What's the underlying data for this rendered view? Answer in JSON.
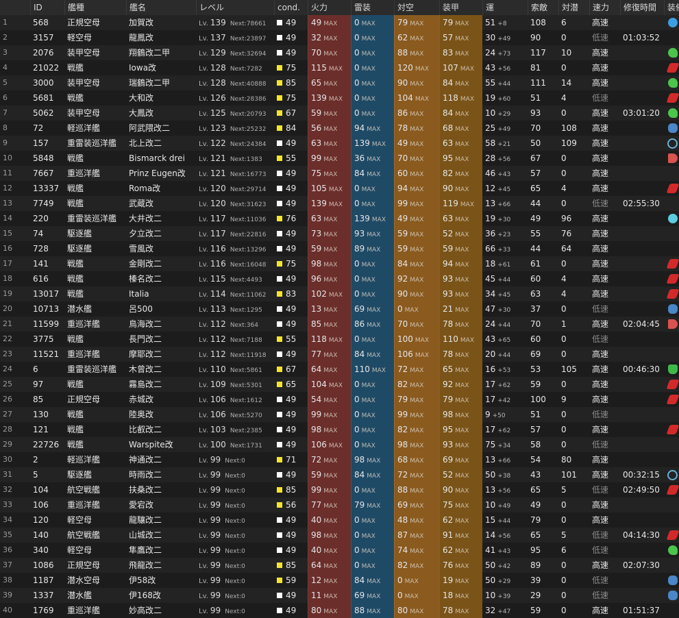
{
  "colors": {
    "fire": "#6b2e2b",
    "torpedo": "#1f4a66",
    "aa": "#8a5a1f",
    "armor": "#7a5318",
    "cond_white": "#ffffff",
    "cond_yellow": "#f5e52e"
  },
  "header": {
    "idx": "",
    "id": "ID",
    "type": "艦種",
    "name": "艦名",
    "level": "レベル",
    "cond": "cond.",
    "fire": "火力",
    "torpedo": "雷装",
    "aa": "対空",
    "armor": "装甲",
    "luck": "運",
    "los": "索敵",
    "asw": "対潜",
    "speed": "速力",
    "repair": "修復時間",
    "equip": "装備"
  },
  "max_label": "MAX",
  "lv_prefix": "Lv.",
  "next_prefix": "Next:",
  "rows": [
    {
      "idx": "1",
      "id": "568",
      "type": "正規空母",
      "name": "加賀改",
      "lv": "139",
      "next": "78661",
      "cond": "49",
      "cc": "w",
      "fire": "49",
      "torp": "0",
      "aa": "79",
      "arm": "79",
      "luck": "51",
      "lup": "+8",
      "los": "108",
      "asw": "6",
      "speed": "高速",
      "repair": "",
      "eq": "blue-plane-icon"
    },
    {
      "idx": "2",
      "id": "3157",
      "type": "軽空母",
      "name": "龍鳳改",
      "lv": "137",
      "next": "23897",
      "cond": "49",
      "cc": "w",
      "fire": "32",
      "torp": "0",
      "aa": "62",
      "arm": "57",
      "luck": "30",
      "lup": "+49",
      "los": "90",
      "asw": "0",
      "speed": "低速",
      "repair": "01:03:52",
      "eq": ""
    },
    {
      "idx": "3",
      "id": "2076",
      "type": "装甲空母",
      "name": "翔鶴改二甲",
      "lv": "129",
      "next": "32694",
      "cond": "49",
      "cc": "w",
      "fire": "70",
      "torp": "0",
      "aa": "88",
      "arm": "83",
      "luck": "24",
      "lup": "+73",
      "los": "117",
      "asw": "10",
      "speed": "高速",
      "repair": "",
      "eq": "green-plane-icon"
    },
    {
      "idx": "4",
      "id": "21022",
      "type": "戦艦",
      "name": "Iowa改",
      "lv": "128",
      "next": "7282",
      "cond": "75",
      "cc": "y",
      "fire": "115",
      "torp": "0",
      "aa": "120",
      "arm": "107",
      "luck": "43",
      "lup": "+56",
      "los": "81",
      "asw": "0",
      "speed": "高速",
      "repair": "",
      "eq": "red-gun-icon"
    },
    {
      "idx": "5",
      "id": "3000",
      "type": "装甲空母",
      "name": "瑞鶴改二甲",
      "lv": "128",
      "next": "40888",
      "cond": "85",
      "cc": "y",
      "fire": "65",
      "torp": "0",
      "aa": "90",
      "arm": "84",
      "luck": "55",
      "lup": "+44",
      "los": "111",
      "asw": "14",
      "speed": "高速",
      "repair": "",
      "eq": "green-plane-icon"
    },
    {
      "idx": "6",
      "id": "5681",
      "type": "戦艦",
      "name": "大和改",
      "lv": "126",
      "next": "28386",
      "cond": "75",
      "cc": "y",
      "fire": "139",
      "torp": "0",
      "aa": "104",
      "arm": "118",
      "luck": "19",
      "lup": "+60",
      "los": "51",
      "asw": "4",
      "speed": "低速",
      "repair": "",
      "eq": "red-gun-icon"
    },
    {
      "idx": "7",
      "id": "5062",
      "type": "装甲空母",
      "name": "大鳳改",
      "lv": "125",
      "next": "20793",
      "cond": "67",
      "cc": "y",
      "fire": "59",
      "torp": "0",
      "aa": "86",
      "arm": "84",
      "luck": "10",
      "lup": "+29",
      "los": "93",
      "asw": "0",
      "speed": "高速",
      "repair": "03:01:20",
      "eq": "green-plane-icon"
    },
    {
      "idx": "8",
      "id": "72",
      "type": "軽巡洋艦",
      "name": "阿武隈改二",
      "lv": "123",
      "next": "25232",
      "cond": "84",
      "cc": "y",
      "fire": "56",
      "torp": "94",
      "aa": "78",
      "arm": "68",
      "luck": "25",
      "lup": "+49",
      "los": "70",
      "asw": "108",
      "speed": "高速",
      "repair": "",
      "eq": "blue-sonar-icon"
    },
    {
      "idx": "9",
      "id": "157",
      "type": "重雷装巡洋艦",
      "name": "北上改二",
      "lv": "122",
      "next": "24384",
      "cond": "49",
      "cc": "w",
      "fire": "63",
      "torp": "139",
      "aa": "49",
      "arm": "63",
      "luck": "58",
      "lup": "+21",
      "los": "50",
      "asw": "109",
      "speed": "高速",
      "repair": "",
      "eq": "radar-icon"
    },
    {
      "idx": "10",
      "id": "5848",
      "type": "戦艦",
      "name": "Bismarck drei",
      "lv": "121",
      "next": "1383",
      "cond": "55",
      "cc": "y",
      "fire": "99",
      "torp": "36",
      "aa": "70",
      "arm": "95",
      "luck": "28",
      "lup": "+56",
      "los": "67",
      "asw": "0",
      "speed": "高速",
      "repair": "",
      "eq": "red-shell-icon"
    },
    {
      "idx": "11",
      "id": "7667",
      "type": "重巡洋艦",
      "name": "Prinz Eugen改",
      "lv": "121",
      "next": "16773",
      "cond": "49",
      "cc": "w",
      "fire": "75",
      "torp": "84",
      "aa": "60",
      "arm": "82",
      "luck": "46",
      "lup": "+43",
      "los": "57",
      "asw": "0",
      "speed": "高速",
      "repair": "",
      "eq": ""
    },
    {
      "idx": "12",
      "id": "13337",
      "type": "戦艦",
      "name": "Roma改",
      "lv": "120",
      "next": "29714",
      "cond": "49",
      "cc": "w",
      "fire": "105",
      "torp": "0",
      "aa": "94",
      "arm": "90",
      "luck": "12",
      "lup": "+45",
      "los": "65",
      "asw": "4",
      "speed": "高速",
      "repair": "",
      "eq": "red-gun-icon"
    },
    {
      "idx": "13",
      "id": "7749",
      "type": "戦艦",
      "name": "武蔵改",
      "lv": "120",
      "next": "31623",
      "cond": "49",
      "cc": "w",
      "fire": "139",
      "torp": "0",
      "aa": "99",
      "arm": "119",
      "luck": "13",
      "lup": "+66",
      "los": "44",
      "asw": "0",
      "speed": "低速",
      "repair": "02:55:30",
      "eq": ""
    },
    {
      "idx": "14",
      "id": "220",
      "type": "重雷装巡洋艦",
      "name": "大井改二",
      "lv": "117",
      "next": "11036",
      "cond": "76",
      "cc": "y",
      "fire": "63",
      "torp": "139",
      "aa": "49",
      "arm": "63",
      "luck": "19",
      "lup": "+30",
      "los": "49",
      "asw": "96",
      "speed": "高速",
      "repair": "",
      "eq": "cyan-torpedo-icon"
    },
    {
      "idx": "15",
      "id": "74",
      "type": "駆逐艦",
      "name": "夕立改二",
      "lv": "117",
      "next": "22816",
      "cond": "49",
      "cc": "w",
      "fire": "73",
      "torp": "93",
      "aa": "59",
      "arm": "52",
      "luck": "36",
      "lup": "+23",
      "los": "55",
      "asw": "76",
      "speed": "高速",
      "repair": "",
      "eq": ""
    },
    {
      "idx": "16",
      "id": "728",
      "type": "駆逐艦",
      "name": "雪風改",
      "lv": "116",
      "next": "13296",
      "cond": "49",
      "cc": "w",
      "fire": "59",
      "torp": "89",
      "aa": "59",
      "arm": "59",
      "luck": "66",
      "lup": "+33",
      "los": "44",
      "asw": "64",
      "speed": "高速",
      "repair": "",
      "eq": ""
    },
    {
      "idx": "17",
      "id": "141",
      "type": "戦艦",
      "name": "金剛改二",
      "lv": "116",
      "next": "16048",
      "cond": "75",
      "cc": "y",
      "fire": "98",
      "torp": "0",
      "aa": "84",
      "arm": "94",
      "luck": "18",
      "lup": "+61",
      "los": "61",
      "asw": "0",
      "speed": "高速",
      "repair": "",
      "eq": "red-gun-icon"
    },
    {
      "idx": "18",
      "id": "616",
      "type": "戦艦",
      "name": "榛名改二",
      "lv": "115",
      "next": "4493",
      "cond": "49",
      "cc": "w",
      "fire": "96",
      "torp": "0",
      "aa": "92",
      "arm": "93",
      "luck": "45",
      "lup": "+44",
      "los": "60",
      "asw": "4",
      "speed": "高速",
      "repair": "",
      "eq": "red-gun-icon"
    },
    {
      "idx": "19",
      "id": "13017",
      "type": "戦艦",
      "name": "Italia",
      "lv": "114",
      "next": "11062",
      "cond": "83",
      "cc": "y",
      "fire": "102",
      "torp": "0",
      "aa": "90",
      "arm": "93",
      "luck": "34",
      "lup": "+45",
      "los": "63",
      "asw": "4",
      "speed": "高速",
      "repair": "",
      "eq": "red-gun-icon"
    },
    {
      "idx": "20",
      "id": "10713",
      "type": "潜水艦",
      "name": "呂500",
      "lv": "113",
      "next": "1295",
      "cond": "49",
      "cc": "w",
      "fire": "13",
      "torp": "69",
      "aa": "0",
      "arm": "21",
      "luck": "47",
      "lup": "+30",
      "los": "37",
      "asw": "0",
      "speed": "低速",
      "repair": "",
      "eq": "blue-sonar-icon"
    },
    {
      "idx": "21",
      "id": "11599",
      "type": "重巡洋艦",
      "name": "鳥海改二",
      "lv": "112",
      "next": "364",
      "cond": "49",
      "cc": "w",
      "fire": "85",
      "torp": "86",
      "aa": "70",
      "arm": "78",
      "luck": "24",
      "lup": "+44",
      "los": "70",
      "asw": "1",
      "speed": "高速",
      "repair": "02:04:45",
      "eq": "red-shell-icon"
    },
    {
      "idx": "22",
      "id": "3775",
      "type": "戦艦",
      "name": "長門改二",
      "lv": "112",
      "next": "7188",
      "cond": "55",
      "cc": "y",
      "fire": "118",
      "torp": "0",
      "aa": "100",
      "arm": "110",
      "luck": "43",
      "lup": "+65",
      "los": "60",
      "asw": "0",
      "speed": "低速",
      "repair": "",
      "eq": ""
    },
    {
      "idx": "23",
      "id": "11521",
      "type": "重巡洋艦",
      "name": "摩耶改二",
      "lv": "112",
      "next": "11918",
      "cond": "49",
      "cc": "w",
      "fire": "77",
      "torp": "84",
      "aa": "106",
      "arm": "78",
      "luck": "20",
      "lup": "+44",
      "los": "69",
      "asw": "0",
      "speed": "高速",
      "repair": "",
      "eq": ""
    },
    {
      "idx": "24",
      "id": "6",
      "type": "重雷装巡洋艦",
      "name": "木曾改二",
      "lv": "110",
      "next": "5861",
      "cond": "67",
      "cc": "y",
      "fire": "64",
      "torp": "110",
      "aa": "72",
      "arm": "65",
      "luck": "16",
      "lup": "+53",
      "los": "53",
      "asw": "105",
      "speed": "高速",
      "repair": "00:46:30",
      "eq": "green-hand-icon"
    },
    {
      "idx": "25",
      "id": "97",
      "type": "戦艦",
      "name": "霧島改二",
      "lv": "109",
      "next": "5301",
      "cond": "65",
      "cc": "y",
      "fire": "104",
      "torp": "0",
      "aa": "82",
      "arm": "92",
      "luck": "17",
      "lup": "+62",
      "los": "59",
      "asw": "0",
      "speed": "高速",
      "repair": "",
      "eq": "red-gun-icon"
    },
    {
      "idx": "26",
      "id": "85",
      "type": "正規空母",
      "name": "赤城改",
      "lv": "106",
      "next": "1612",
      "cond": "49",
      "cc": "w",
      "fire": "54",
      "torp": "0",
      "aa": "79",
      "arm": "79",
      "luck": "17",
      "lup": "+42",
      "los": "100",
      "asw": "9",
      "speed": "高速",
      "repair": "",
      "eq": "red-gun-icon"
    },
    {
      "idx": "27",
      "id": "130",
      "type": "戦艦",
      "name": "陸奥改",
      "lv": "106",
      "next": "5270",
      "cond": "49",
      "cc": "w",
      "fire": "99",
      "torp": "0",
      "aa": "99",
      "arm": "98",
      "luck": "9",
      "lup": "+50",
      "los": "51",
      "asw": "0",
      "speed": "低速",
      "repair": "",
      "eq": ""
    },
    {
      "idx": "28",
      "id": "121",
      "type": "戦艦",
      "name": "比叡改二",
      "lv": "103",
      "next": "2385",
      "cond": "49",
      "cc": "w",
      "fire": "98",
      "torp": "0",
      "aa": "82",
      "arm": "95",
      "luck": "17",
      "lup": "+62",
      "los": "57",
      "asw": "0",
      "speed": "高速",
      "repair": "",
      "eq": "red-gun-icon"
    },
    {
      "idx": "29",
      "id": "22726",
      "type": "戦艦",
      "name": "Warspite改",
      "lv": "100",
      "next": "1731",
      "cond": "49",
      "cc": "w",
      "fire": "106",
      "torp": "0",
      "aa": "98",
      "arm": "93",
      "luck": "75",
      "lup": "+34",
      "los": "58",
      "asw": "0",
      "speed": "低速",
      "repair": "",
      "eq": ""
    },
    {
      "idx": "30",
      "id": "2",
      "type": "軽巡洋艦",
      "name": "神通改二",
      "lv": "99",
      "next": "0",
      "cond": "71",
      "cc": "y",
      "fire": "72",
      "torp": "98",
      "aa": "68",
      "arm": "69",
      "luck": "13",
      "lup": "+66",
      "los": "54",
      "asw": "80",
      "speed": "高速",
      "repair": "",
      "eq": ""
    },
    {
      "idx": "31",
      "id": "5",
      "type": "駆逐艦",
      "name": "時雨改二",
      "lv": "99",
      "next": "0",
      "cond": "49",
      "cc": "w",
      "fire": "59",
      "torp": "84",
      "aa": "72",
      "arm": "52",
      "luck": "50",
      "lup": "+38",
      "los": "43",
      "asw": "101",
      "speed": "高速",
      "repair": "00:32:15",
      "eq": "radar-icon"
    },
    {
      "idx": "32",
      "id": "104",
      "type": "航空戦艦",
      "name": "扶桑改二",
      "lv": "99",
      "next": "0",
      "cond": "85",
      "cc": "y",
      "fire": "99",
      "torp": "0",
      "aa": "88",
      "arm": "90",
      "luck": "13",
      "lup": "+56",
      "los": "65",
      "asw": "5",
      "speed": "低速",
      "repair": "02:49:50",
      "eq": "red-gun-icon"
    },
    {
      "idx": "33",
      "id": "106",
      "type": "重巡洋艦",
      "name": "愛宕改",
      "lv": "99",
      "next": "0",
      "cond": "56",
      "cc": "y",
      "fire": "77",
      "torp": "79",
      "aa": "69",
      "arm": "75",
      "luck": "10",
      "lup": "+49",
      "los": "49",
      "asw": "0",
      "speed": "高速",
      "repair": "",
      "eq": ""
    },
    {
      "idx": "34",
      "id": "120",
      "type": "軽空母",
      "name": "龍驤改二",
      "lv": "99",
      "next": "0",
      "cond": "49",
      "cc": "w",
      "fire": "40",
      "torp": "0",
      "aa": "48",
      "arm": "62",
      "luck": "15",
      "lup": "+44",
      "los": "79",
      "asw": "0",
      "speed": "高速",
      "repair": "",
      "eq": ""
    },
    {
      "idx": "35",
      "id": "140",
      "type": "航空戦艦",
      "name": "山城改二",
      "lv": "99",
      "next": "0",
      "cond": "49",
      "cc": "w",
      "fire": "98",
      "torp": "0",
      "aa": "87",
      "arm": "91",
      "luck": "14",
      "lup": "+56",
      "los": "65",
      "asw": "5",
      "speed": "低速",
      "repair": "04:14:30",
      "eq": "red-gun-icon"
    },
    {
      "idx": "36",
      "id": "340",
      "type": "軽空母",
      "name": "隼鷹改二",
      "lv": "99",
      "next": "0",
      "cond": "49",
      "cc": "w",
      "fire": "40",
      "torp": "0",
      "aa": "74",
      "arm": "62",
      "luck": "41",
      "lup": "+43",
      "los": "95",
      "asw": "6",
      "speed": "低速",
      "repair": "",
      "eq": "green-plane-icon"
    },
    {
      "idx": "37",
      "id": "1086",
      "type": "正規空母",
      "name": "飛龍改二",
      "lv": "99",
      "next": "0",
      "cond": "85",
      "cc": "y",
      "fire": "64",
      "torp": "0",
      "aa": "82",
      "arm": "76",
      "luck": "50",
      "lup": "+42",
      "los": "89",
      "asw": "0",
      "speed": "高速",
      "repair": "02:07:30",
      "eq": ""
    },
    {
      "idx": "38",
      "id": "1187",
      "type": "潜水空母",
      "name": "伊58改",
      "lv": "99",
      "next": "0",
      "cond": "59",
      "cc": "y",
      "fire": "12",
      "torp": "84",
      "aa": "0",
      "arm": "19",
      "luck": "50",
      "lup": "+29",
      "los": "39",
      "asw": "0",
      "speed": "低速",
      "repair": "",
      "eq": "blue-sonar-icon"
    },
    {
      "idx": "39",
      "id": "1337",
      "type": "潜水艦",
      "name": "伊168改",
      "lv": "99",
      "next": "0",
      "cond": "49",
      "cc": "w",
      "fire": "11",
      "torp": "69",
      "aa": "0",
      "arm": "18",
      "luck": "10",
      "lup": "+39",
      "los": "29",
      "asw": "0",
      "speed": "低速",
      "repair": "",
      "eq": "blue-sonar-icon"
    },
    {
      "idx": "40",
      "id": "1769",
      "type": "重巡洋艦",
      "name": "妙高改二",
      "lv": "99",
      "next": "0",
      "cond": "49",
      "cc": "w",
      "fire": "80",
      "torp": "88",
      "aa": "80",
      "arm": "78",
      "luck": "32",
      "lup": "+47",
      "los": "59",
      "asw": "0",
      "speed": "高速",
      "repair": "01:51:37",
      "eq": ""
    }
  ]
}
